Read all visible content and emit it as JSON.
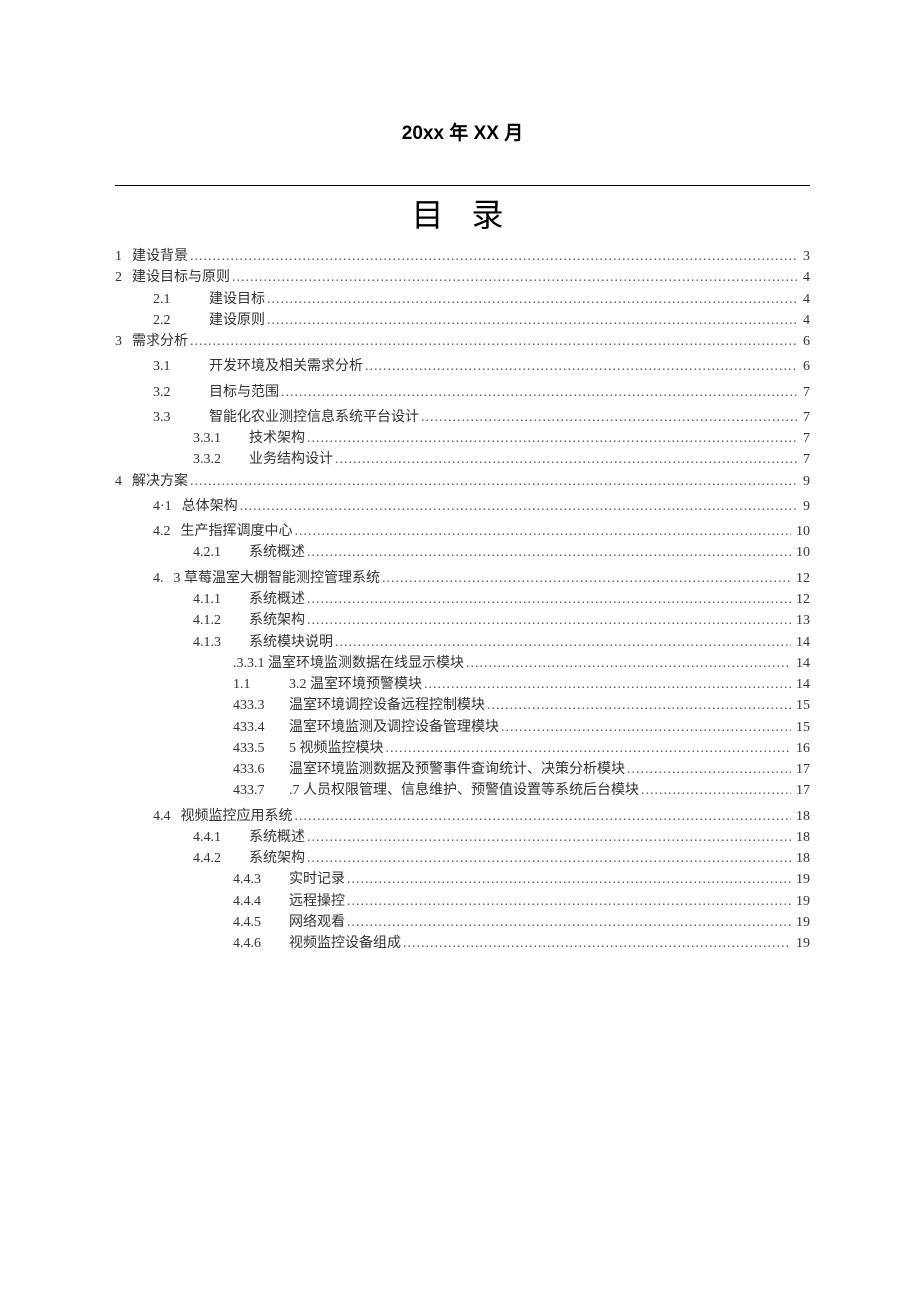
{
  "date_header": "20xx 年 XX 月",
  "title": "目 录",
  "toc": [
    {
      "level": 0,
      "num": "1",
      "label": "建设背景",
      "page": "3",
      "numClass": ""
    },
    {
      "level": 0,
      "num": "2",
      "label": "建设目标与原则",
      "page": "4",
      "numClass": ""
    },
    {
      "level": 1,
      "num": "2.1",
      "label": "建设目标",
      "page": "4",
      "numClass": "num-wide"
    },
    {
      "level": 1,
      "num": "2.2",
      "label": "建设原则",
      "page": "4",
      "numClass": "num-wide"
    },
    {
      "level": 0,
      "num": "3",
      "label": "需求分析",
      "page": "6",
      "numClass": ""
    },
    {
      "level": 1,
      "num": "3.1",
      "label": "开发环境及相关需求分析",
      "page": "6",
      "numClass": "num-wide",
      "spaceBefore": true
    },
    {
      "level": 1,
      "num": "3.2",
      "label": "目标与范围",
      "page": "7",
      "numClass": "num-wide",
      "spaceBefore": true
    },
    {
      "level": 1,
      "num": "3.3",
      "label": "智能化农业测控信息系统平台设计",
      "page": "7",
      "numClass": "num-wide",
      "spaceBefore": true
    },
    {
      "level": 2,
      "num": "3.3.1",
      "label": "技术架构",
      "page": "7",
      "numClass": "num-wide"
    },
    {
      "level": 2,
      "num": "3.3.2",
      "label": "业务结构设计",
      "page": "7",
      "numClass": "num-wide"
    },
    {
      "level": 0,
      "num": "4",
      "label": "解决方案",
      "page": "9",
      "numClass": ""
    },
    {
      "level": 1,
      "num": "4·1",
      "label": "总体架构",
      "page": "9",
      "numClass": "",
      "spaceBefore": true
    },
    {
      "level": 1,
      "num": "4.2",
      "label": "生产指挥调度中心",
      "page": "10",
      "numClass": "",
      "spaceBefore": true
    },
    {
      "level": 2,
      "num": "4.2.1",
      "label": "系统概述",
      "page": "10",
      "numClass": "num-wide"
    },
    {
      "level": 1,
      "num": "4.",
      "label": "3 草莓温室大棚智能测控管理系统",
      "page": "12",
      "numClass": "",
      "spaceBefore": true
    },
    {
      "level": 2,
      "num": "4.1.1",
      "label": "系统概述",
      "page": "12",
      "numClass": "num-wide"
    },
    {
      "level": 2,
      "num": "4.1.2",
      "label": "系统架构",
      "page": "13",
      "numClass": "num-wide"
    },
    {
      "level": 2,
      "num": "4.1.3",
      "label": "系统模块说明",
      "page": "14",
      "numClass": "num-wide"
    },
    {
      "level": 3,
      "num": "",
      "label": ".3.3.1 温室环境监测数据在线显示模块",
      "page": "14",
      "numClass": ""
    },
    {
      "level": 3,
      "num": "1.1",
      "label": "3.2 温室环境预警模块",
      "page": "14",
      "numClass": "num-wide"
    },
    {
      "level": 3,
      "num": "433.3",
      "label": "温室环境调控设备远程控制模块",
      "page": "15",
      "numClass": "num-wide"
    },
    {
      "level": 3,
      "num": "433.4",
      "label": "温室环境监测及调控设备管理模块",
      "page": "15",
      "numClass": "num-wide"
    },
    {
      "level": 3,
      "num": "433.5",
      "label": "5 视频监控模块",
      "page": "16",
      "numClass": "num-wide"
    },
    {
      "level": 3,
      "num": "433.6",
      "label": "温室环境监测数据及预警事件查询统计、决策分析模块",
      "page": "17",
      "numClass": "num-wide"
    },
    {
      "level": 3,
      "num": "433.7",
      "label": ".7 人员权限管理、信息维护、预警值设置等系统后台模块",
      "page": "17",
      "numClass": "num-wide"
    },
    {
      "level": 1,
      "num": "4.4",
      "label": "视频监控应用系统",
      "page": "18",
      "numClass": "",
      "spaceBefore": true
    },
    {
      "level": 2,
      "num": "4.4.1",
      "label": "系统概述",
      "page": "18",
      "numClass": "num-wide"
    },
    {
      "level": 2,
      "num": "4.4.2",
      "label": "系统架构",
      "page": "18",
      "numClass": "num-wide"
    },
    {
      "level": 3,
      "num": "4.4.3",
      "label": "实时记录",
      "page": "19",
      "numClass": "num-wide"
    },
    {
      "level": 3,
      "num": "4.4.4",
      "label": "远程操控",
      "page": "19",
      "numClass": "num-wide"
    },
    {
      "level": 3,
      "num": "4.4.5",
      "label": "网络观看",
      "page": "19",
      "numClass": "num-wide"
    },
    {
      "level": 3,
      "num": "4.4.6",
      "label": "视频监控设备组成",
      "page": "19",
      "numClass": "num-wide"
    }
  ]
}
